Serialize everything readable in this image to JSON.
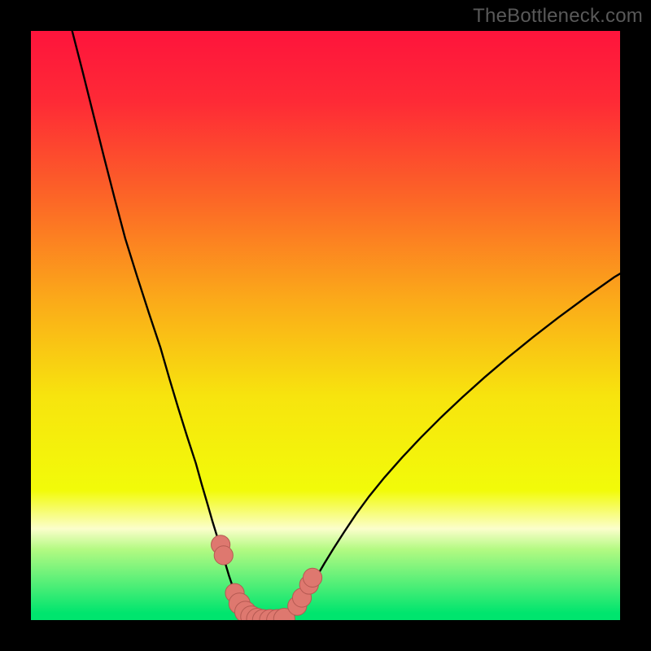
{
  "watermark": "TheBottleneck.com",
  "colors": {
    "frame": "#000000",
    "curve": "#000000",
    "marker_fill": "#de786f",
    "marker_stroke": "#b55a52",
    "gradient_stops": [
      {
        "offset": 0.0,
        "color": "#fe143c"
      },
      {
        "offset": 0.12,
        "color": "#fe2a36"
      },
      {
        "offset": 0.28,
        "color": "#fc6427"
      },
      {
        "offset": 0.46,
        "color": "#fbab19"
      },
      {
        "offset": 0.62,
        "color": "#f7e40e"
      },
      {
        "offset": 0.78,
        "color": "#f2fb09"
      },
      {
        "offset": 0.845,
        "color": "#fbfecb"
      },
      {
        "offset": 0.88,
        "color": "#b3fa82"
      },
      {
        "offset": 0.988,
        "color": "#00e56e"
      },
      {
        "offset": 1.0,
        "color": "#00e56e"
      }
    ]
  },
  "chart_data": {
    "type": "line",
    "title": "",
    "xlabel": "",
    "ylabel": "",
    "x_range": [
      0,
      100
    ],
    "y_range": [
      0,
      100
    ],
    "curves": [
      {
        "name": "left-curve",
        "points": [
          [
            7.0,
            100.0
          ],
          [
            8.8,
            93.0
          ],
          [
            10.6,
            85.8
          ],
          [
            12.4,
            78.6
          ],
          [
            14.2,
            71.6
          ],
          [
            16.0,
            64.8
          ],
          [
            18.0,
            58.4
          ],
          [
            20.0,
            52.2
          ],
          [
            22.0,
            46.2
          ],
          [
            23.5,
            41.0
          ],
          [
            25.0,
            36.0
          ],
          [
            26.5,
            31.2
          ],
          [
            28.0,
            26.6
          ],
          [
            29.0,
            23.0
          ],
          [
            30.0,
            19.6
          ],
          [
            30.8,
            16.8
          ],
          [
            31.6,
            14.2
          ],
          [
            32.3,
            11.8
          ],
          [
            33.0,
            9.6
          ],
          [
            33.6,
            7.6
          ],
          [
            34.2,
            5.8
          ],
          [
            34.8,
            4.2
          ],
          [
            35.4,
            2.8
          ],
          [
            36.0,
            1.6
          ],
          [
            36.6,
            0.7
          ],
          [
            37.2,
            0.2
          ],
          [
            37.8,
            0.0
          ]
        ]
      },
      {
        "name": "right-curve",
        "points": [
          [
            43.0,
            0.0
          ],
          [
            43.8,
            0.2
          ],
          [
            44.6,
            0.8
          ],
          [
            45.4,
            1.8
          ],
          [
            46.2,
            3.2
          ],
          [
            47.2,
            5.0
          ],
          [
            48.4,
            7.2
          ],
          [
            49.8,
            9.6
          ],
          [
            51.4,
            12.2
          ],
          [
            53.2,
            15.0
          ],
          [
            55.2,
            18.0
          ],
          [
            57.4,
            21.0
          ],
          [
            60.0,
            24.2
          ],
          [
            63.0,
            27.6
          ],
          [
            66.2,
            31.0
          ],
          [
            69.6,
            34.4
          ],
          [
            73.2,
            37.8
          ],
          [
            77.0,
            41.2
          ],
          [
            81.0,
            44.6
          ],
          [
            85.2,
            48.0
          ],
          [
            89.6,
            51.4
          ],
          [
            94.2,
            54.8
          ],
          [
            99.0,
            58.2
          ],
          [
            100.0,
            58.8
          ]
        ]
      }
    ],
    "flat_segment": {
      "y": 0.0,
      "x_start": 37.8,
      "x_end": 43.0
    },
    "markers": [
      {
        "x": 32.2,
        "y": 12.8,
        "r": 1.6
      },
      {
        "x": 32.7,
        "y": 11.0,
        "r": 1.6
      },
      {
        "x": 34.6,
        "y": 4.6,
        "r": 1.6
      },
      {
        "x": 35.4,
        "y": 2.8,
        "r": 1.8
      },
      {
        "x": 36.4,
        "y": 1.4,
        "r": 1.8
      },
      {
        "x": 37.4,
        "y": 0.6,
        "r": 1.8
      },
      {
        "x": 38.4,
        "y": 0.2,
        "r": 1.8
      },
      {
        "x": 39.4,
        "y": 0.0,
        "r": 1.8
      },
      {
        "x": 40.6,
        "y": 0.0,
        "r": 1.8
      },
      {
        "x": 41.8,
        "y": 0.0,
        "r": 1.8
      },
      {
        "x": 43.0,
        "y": 0.2,
        "r": 1.8
      },
      {
        "x": 45.2,
        "y": 2.4,
        "r": 1.6
      },
      {
        "x": 46.0,
        "y": 3.8,
        "r": 1.6
      },
      {
        "x": 47.2,
        "y": 6.0,
        "r": 1.6
      },
      {
        "x": 47.8,
        "y": 7.2,
        "r": 1.6
      }
    ]
  }
}
